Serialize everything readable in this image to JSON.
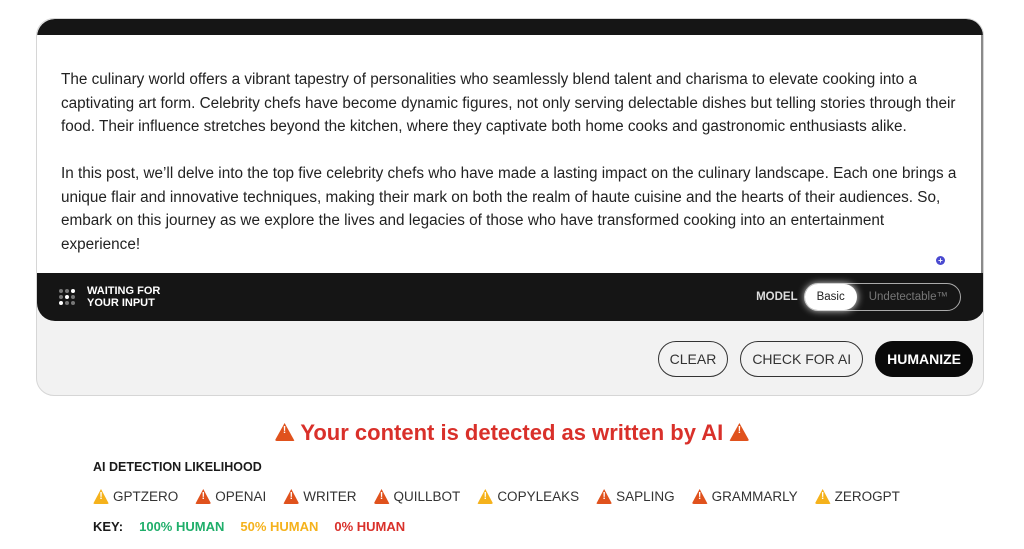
{
  "editor": {
    "paragraphs": [
      "The culinary world offers a vibrant tapestry of personalities who seamlessly blend talent and charisma to elevate cooking into a captivating art form. Celebrity chefs have become dynamic figures, not only serving delectable dishes but telling stories through their food. Their influence stretches beyond the kitchen, where they captivate both home cooks and gastronomic enthusiasts alike.",
      "In this post, we’ll delve into the top five celebrity chefs who have made a lasting impact on the culinary landscape. Each one brings a unique flair and innovative techniques, making their mark on both the realm of haute cuisine and the hearts of their audiences. So, embark on this journey as we explore the lives and legacies of those who have transformed cooking into an entertainment experience!"
    ],
    "status": "WAITING FOR YOUR INPUT",
    "model_label": "MODEL",
    "model_options": [
      "Basic",
      "Undetectable™"
    ],
    "model_selected": "Basic"
  },
  "actions": {
    "clear": "CLEAR",
    "check": "CHECK FOR AI",
    "humanize": "HUMANIZE"
  },
  "result": {
    "alert": "Your content is detected as written by AI",
    "likelihood_title": "AI DETECTION LIKELIHOOD",
    "detectors": [
      {
        "name": "GPTZERO",
        "level": "50% HUMAN"
      },
      {
        "name": "OPENAI",
        "level": "0% HUMAN"
      },
      {
        "name": "WRITER",
        "level": "0% HUMAN"
      },
      {
        "name": "QUILLBOT",
        "level": "0% HUMAN"
      },
      {
        "name": "COPYLEAKS",
        "level": "50% HUMAN"
      },
      {
        "name": "SAPLING",
        "level": "0% HUMAN"
      },
      {
        "name": "GRAMMARLY",
        "level": "0% HUMAN"
      },
      {
        "name": "ZEROGPT",
        "level": "50% HUMAN"
      }
    ],
    "key_label": "KEY:",
    "key": [
      {
        "label": "100% HUMAN",
        "color": "#1fae6a"
      },
      {
        "label": "50% HUMAN",
        "color": "#f5b21c"
      },
      {
        "label": "0% HUMAN",
        "color": "#d9302a"
      }
    ]
  },
  "colors": {
    "alert": "#d9302a",
    "warn_orange": "#e0521d",
    "warn_yellow": "#f5b21c"
  }
}
